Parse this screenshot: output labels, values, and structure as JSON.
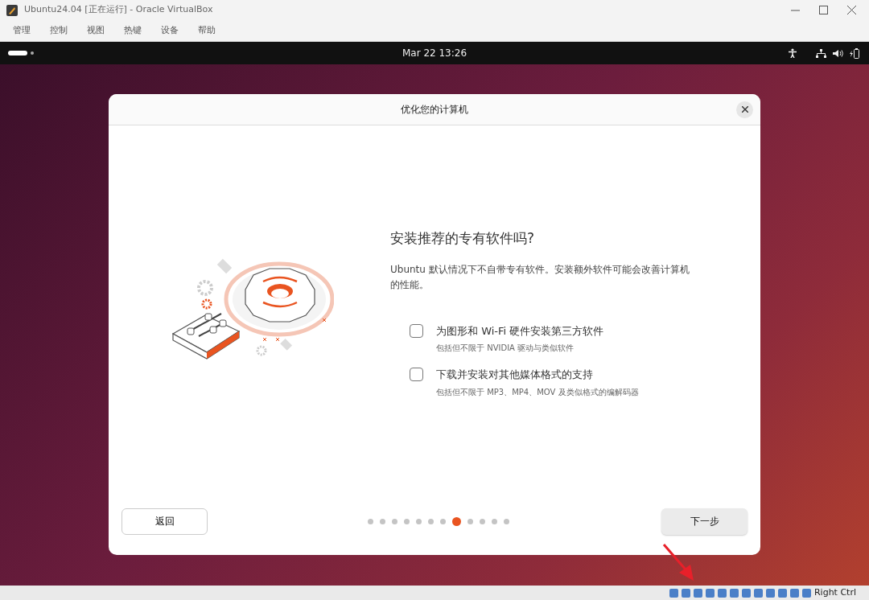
{
  "window": {
    "title": "Ubuntu24.04 [正在运行] - Oracle VirtualBox"
  },
  "menu": [
    "管理",
    "控制",
    "视图",
    "热键",
    "设备",
    "帮助"
  ],
  "top_bar": {
    "clock": "Mar 22  13:26"
  },
  "dialog": {
    "title": "优化您的计算机",
    "heading": "安装推荐的专有软件吗?",
    "description": "Ubuntu 默认情况下不自带专有软件。安装额外软件可能会改善计算机的性能。",
    "options": [
      {
        "label": "为图形和 Wi-Fi 硬件安装第三方软件",
        "hint": "包括但不限于 NVIDIA 驱动与类似软件",
        "checked": false
      },
      {
        "label": "下载并安装对其他媒体格式的支持",
        "hint": "包括但不限于 MP3、MP4、MOV 及类似格式的编解码器",
        "checked": false
      }
    ],
    "back_button": "返回",
    "next_button": "下一步",
    "steps": [
      {
        "selected": false
      },
      {
        "selected": false
      },
      {
        "selected": false
      },
      {
        "selected": false
      },
      {
        "selected": false
      },
      {
        "selected": false
      },
      {
        "selected": false
      },
      {
        "selected": true
      },
      {
        "selected": false
      },
      {
        "selected": false
      },
      {
        "selected": false
      },
      {
        "selected": false
      }
    ]
  },
  "status_bar": {
    "host_key": "Right Ctrl"
  }
}
